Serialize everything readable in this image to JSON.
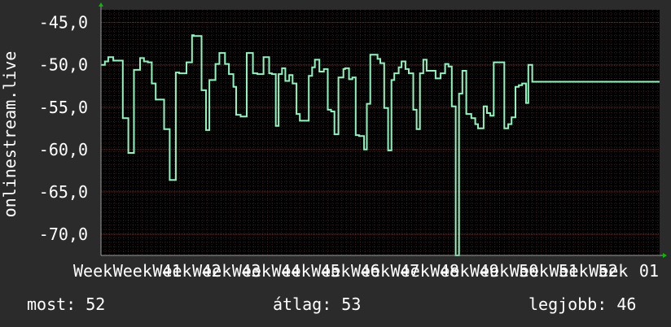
{
  "colors": {
    "background": "#2b2b2b",
    "plot_background": "#000000",
    "grid": "#5a3a3a",
    "line": "#8ff5bf",
    "axis_arrow": "#00c000",
    "text": "#ffffff"
  },
  "stats": {
    "now": "most: 52",
    "avg": "átlag: 53",
    "best": "legjobb: 46"
  },
  "chart_data": {
    "type": "line",
    "title": "",
    "ylabel": "onlinestream.live",
    "xlabel": "",
    "ylim": [
      -72.5,
      -43.5
    ],
    "xlim": [
      0,
      100
    ],
    "y_ticks": [
      -45,
      -50,
      -55,
      -60,
      -65,
      -70
    ],
    "y_tick_labels": [
      "-45,0",
      "-50,0",
      "-55,0",
      "-60,0",
      "-65,0",
      "-70,0"
    ],
    "x_tick_positions": [
      0,
      7.1,
      14.2,
      21.3,
      28.4,
      35.5,
      42.6,
      49.7,
      56.8,
      63.9,
      71.0,
      78.1,
      85.2,
      92.3,
      99.4
    ],
    "x_tick_labels": [
      "Week",
      "Week 41",
      "Week 42",
      "Week 43",
      "Week 44",
      "Week 45",
      "Week 46",
      "Week 47",
      "Week 48",
      "Week 49",
      "Week 50",
      "Week 51",
      "Week 52",
      "Week",
      "01"
    ],
    "grid": true,
    "series": [
      {
        "name": "",
        "x": [
          0,
          0.7,
          1.3,
          2.2,
          3.1,
          3.9,
          4.2,
          4.9,
          5.2,
          5.9,
          6.3,
          7.0,
          7.7,
          8.4,
          9.1,
          9.8,
          10.4,
          11.3,
          11.7,
          12.3,
          12.9,
          13.4,
          14.0,
          14.3,
          15.3,
          15.5,
          16.3,
          16.6,
          17.2,
          18.0,
          18.8,
          19.2,
          19.4,
          20.1,
          20.5,
          21.2,
          21.6,
          22.2,
          22.9,
          23.7,
          24.2,
          25.0,
          26.1,
          26.3,
          27.2,
          28.0,
          29.1,
          29.3,
          30.1,
          30.6,
          31.3,
          31.8,
          32.4,
          33.0,
          33.7,
          34.3,
          35.0,
          35.6,
          36.1,
          37.2,
          37.8,
          38.3,
          39.1,
          39.9,
          40.6,
          41.2,
          41.8,
          42.5,
          43.4,
          43.7,
          44.4,
          45.0,
          45.6,
          46.2,
          47.1,
          47.6,
          48.2,
          48.6,
          49.5,
          50.0,
          50.7,
          51.4,
          52.0,
          52.5,
          53.3,
          53.8,
          54.5,
          55.1,
          55.9,
          56.5,
          57.1,
          57.7,
          58.3,
          59.0,
          59.9,
          60.8,
          61.6,
          62.2,
          62.8,
          63.5,
          64.1,
          64.7,
          65.4,
          66.3,
          67.0,
          67.5,
          68.5,
          69.1,
          69.7,
          70.3,
          71.0,
          71.6,
          72.2,
          72.9,
          73.5,
          74.2,
          74.8,
          75.4,
          76.1,
          76.5,
          77.2,
          77.9,
          78.3,
          78.9,
          79.6,
          80.2,
          80.6,
          81.3,
          82.0,
          82.8,
          83.4,
          83.9,
          84.6,
          85.2,
          86.5,
          87.1,
          87.8,
          88.2,
          88.9,
          89.6,
          90.2,
          91.0,
          91.6,
          92.2,
          93.0,
          93.8,
          94.5,
          95.3,
          95.9,
          96.5,
          97.0,
          97.7,
          98.2,
          98.8,
          99.5,
          100.0
        ],
        "values": [
          -50.0,
          -49.6,
          -49.1,
          -49.5,
          -49.5,
          -56.3,
          -56.3,
          -60.4,
          -60.4,
          -50.6,
          -50.6,
          -49.2,
          -49.6,
          -49.7,
          -52.2,
          -54.1,
          -54.1,
          -57.6,
          -57.6,
          -63.6,
          -63.6,
          -50.9,
          -51.0,
          -51.0,
          -49.7,
          -49.7,
          -46.5,
          -46.6,
          -46.6,
          -53.0,
          -57.7,
          -57.7,
          -51.8,
          -51.8,
          -49.9,
          -48.6,
          -48.6,
          -49.9,
          -51.1,
          -52.6,
          -55.9,
          -56.1,
          -48.6,
          -48.6,
          -51.0,
          -51.1,
          -49.1,
          -49.1,
          -51.0,
          -51.1,
          -57.2,
          -51.1,
          -50.4,
          -51.9,
          -51.2,
          -52.2,
          -55.8,
          -56.6,
          -56.6,
          -51.3,
          -50.3,
          -49.4,
          -50.8,
          -50.5,
          -55.3,
          -55.5,
          -58.2,
          -51.5,
          -50.5,
          -50.4,
          -51.7,
          -51.5,
          -58.3,
          -58.4,
          -60.0,
          -54.6,
          -48.8,
          -48.8,
          -49.3,
          -49.8,
          -55.1,
          -60.1,
          -51.8,
          -51.0,
          -50.3,
          -49.6,
          -50.5,
          -51.0,
          -55.3,
          -57.6,
          -51.0,
          -49.4,
          -50.7,
          -50.7,
          -51.6,
          -51.0,
          -49.9,
          -50.2,
          -54.9,
          -72.5,
          -53.4,
          -50.7,
          -55.8,
          -56.3,
          -57.0,
          -57.5,
          -54.9,
          -55.7,
          -56.0,
          -49.7,
          -49.7,
          -49.7,
          -57.5,
          -57.0,
          -56.2,
          -52.6,
          -52.4,
          -52.2,
          -54.5,
          -50.0,
          -52.0,
          -52.0,
          -52.0,
          -52.0,
          -52.0,
          -52.0,
          -52.0,
          -52.0,
          -52.0,
          -52.0,
          -52.0,
          -52.0,
          -52.0,
          -52.0,
          -52.0,
          -52.0,
          -52.0,
          -52.0,
          -52.0,
          -52.0,
          -52.0,
          -52.0,
          -52.0,
          -52.0,
          -52.0,
          -52.0,
          -52.0,
          -52.0,
          -52.0,
          -52.0,
          -52.0,
          -52.0,
          -52.0,
          -52.0,
          -52.0,
          -52.0
        ]
      }
    ]
  }
}
